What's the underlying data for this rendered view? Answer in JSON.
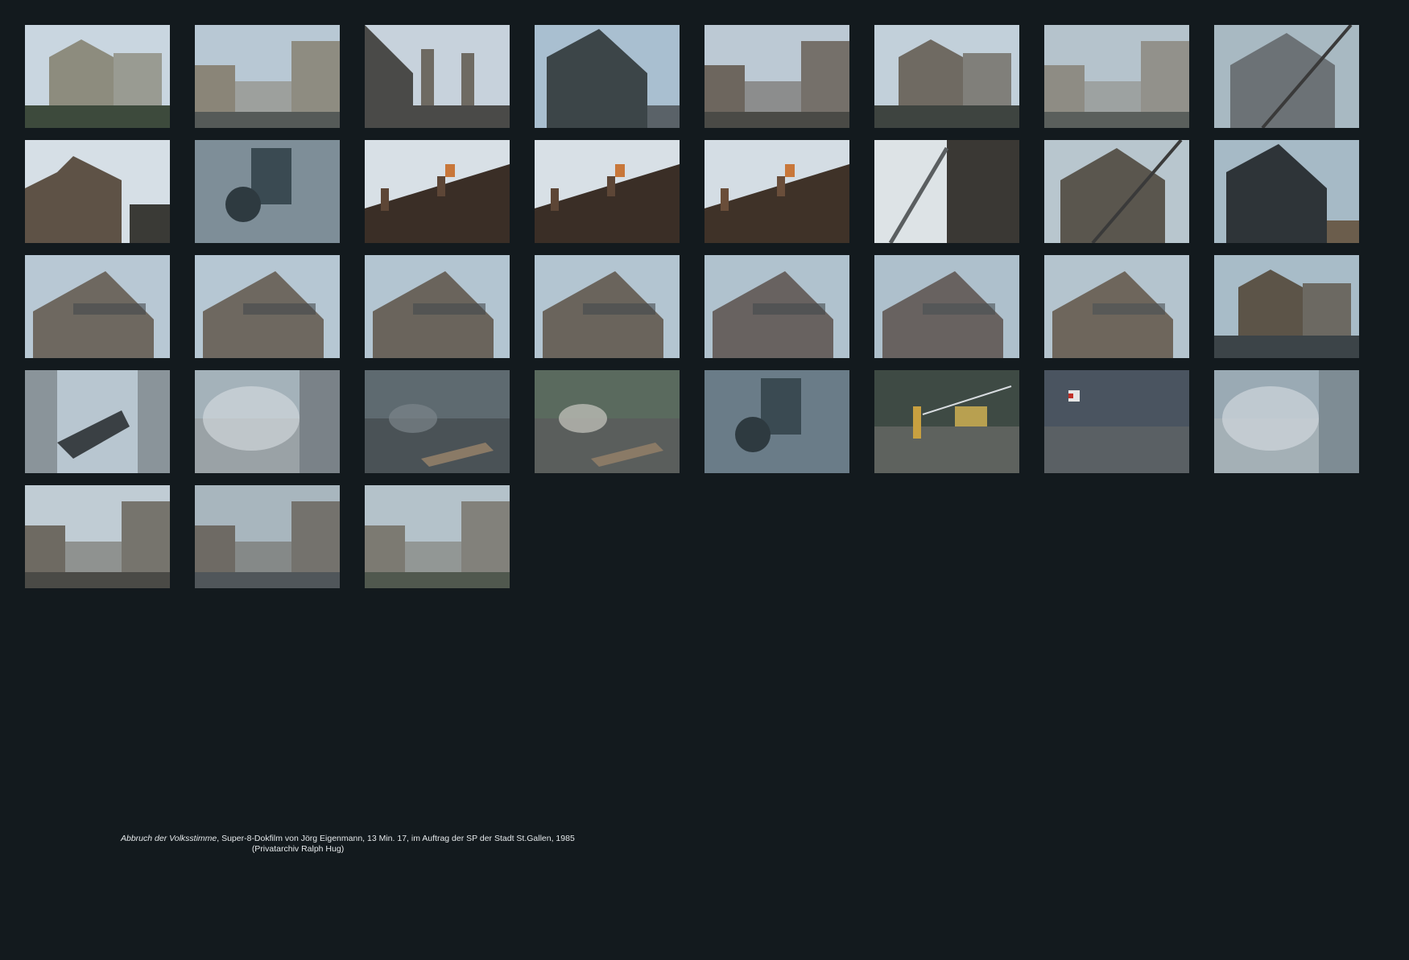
{
  "caption": {
    "title": "Abbruch der Volksstimme",
    "details": ", Super-8-Dokfilm von Jörg Eigenmann, 13 Min. 17, im Auftrag der SP der Stadt St.Gallen, 1985",
    "credit": "(Privatarchiv Ralph Hug)"
  },
  "frames": [
    {
      "name": "film-still-01",
      "scene": "house",
      "sky": "#c9d6e0",
      "ground": "#3d4a3c",
      "tone": "#8d8c7e"
    },
    {
      "name": "film-still-02",
      "scene": "street",
      "sky": "#b8c8d4",
      "ground": "#555a58",
      "tone": "#8a8578"
    },
    {
      "name": "film-still-03",
      "scene": "towers",
      "sky": "#c7d2dc",
      "ground": "#4a4a48",
      "tone": "#6e6a62"
    },
    {
      "name": "film-still-04",
      "scene": "gable",
      "sky": "#a9bfd0",
      "ground": "#3c4548",
      "tone": "#5a6268"
    },
    {
      "name": "film-still-05",
      "scene": "street",
      "sky": "#bcc9d4",
      "ground": "#4a4a46",
      "tone": "#6d665e"
    },
    {
      "name": "film-still-06",
      "scene": "house",
      "sky": "#c2d0da",
      "ground": "#3e4440",
      "tone": "#6f6a62"
    },
    {
      "name": "film-still-07",
      "scene": "street",
      "sky": "#b5c3cc",
      "ground": "#5a5f5c",
      "tone": "#8e8c84"
    },
    {
      "name": "film-still-08",
      "scene": "crane",
      "sky": "#a8b9c2",
      "ground": "#4a5256",
      "tone": "#6c7276"
    },
    {
      "name": "film-still-09",
      "scene": "ruin",
      "sky": "#d6dfe6",
      "ground": "#3a3a36",
      "tone": "#5e5246"
    },
    {
      "name": "film-still-10",
      "scene": "wall",
      "sky": "#9eb2be",
      "ground": "#7e8e98",
      "tone": "#8ea0ac"
    },
    {
      "name": "film-still-11",
      "scene": "roof",
      "sky": "#d8e0e6",
      "ground": "#3a2e26",
      "tone": "#5d4636"
    },
    {
      "name": "film-still-12",
      "scene": "roof",
      "sky": "#d8e0e6",
      "ground": "#3a2e26",
      "tone": "#5d4636"
    },
    {
      "name": "film-still-13",
      "scene": "roof",
      "sky": "#d4dde4",
      "ground": "#3f3228",
      "tone": "#6a4e3a"
    },
    {
      "name": "film-still-14",
      "scene": "ladder",
      "sky": "#cfd8de",
      "ground": "#3a3834",
      "tone": "#7c6a58"
    },
    {
      "name": "film-still-15",
      "scene": "crane",
      "sky": "#b8c6ce",
      "ground": "#3c3e3c",
      "tone": "#5a564e"
    },
    {
      "name": "film-still-16",
      "scene": "gable",
      "sky": "#a6bac6",
      "ground": "#2e3438",
      "tone": "#6b5d4c"
    },
    {
      "name": "film-still-17",
      "scene": "sign",
      "sky": "#b8c8d4",
      "ground": "#454a4c",
      "tone": "#6e6860"
    },
    {
      "name": "film-still-18",
      "scene": "sign",
      "sky": "#b6c7d3",
      "ground": "#454a4c",
      "tone": "#6e6860"
    },
    {
      "name": "film-still-19",
      "scene": "sign",
      "sky": "#b3c5d1",
      "ground": "#454a4c",
      "tone": "#6a645c"
    },
    {
      "name": "film-still-20",
      "scene": "sign",
      "sky": "#b3c5d1",
      "ground": "#454a4c",
      "tone": "#6a645c"
    },
    {
      "name": "film-still-21",
      "scene": "sign",
      "sky": "#b0c2ce",
      "ground": "#454a4c",
      "tone": "#686260"
    },
    {
      "name": "film-still-22",
      "scene": "sign",
      "sky": "#aec0cc",
      "ground": "#4a5054",
      "tone": "#686260"
    },
    {
      "name": "film-still-23",
      "scene": "sign",
      "sky": "#b4c4ce",
      "ground": "#4a5054",
      "tone": "#6e665c"
    },
    {
      "name": "film-still-24",
      "scene": "house",
      "sky": "#a8bcc8",
      "ground": "#3c4448",
      "tone": "#5c5448"
    },
    {
      "name": "film-still-25",
      "scene": "wreck",
      "sky": "#b8c6d0",
      "ground": "#6e7a82",
      "tone": "#8a949a"
    },
    {
      "name": "film-still-26",
      "scene": "dust",
      "sky": "#a4b2ba",
      "ground": "#7a8288",
      "tone": "#9aa2a6"
    },
    {
      "name": "film-still-27",
      "scene": "rubble",
      "sky": "#5e6a70",
      "ground": "#4a5256",
      "tone": "#7a848a"
    },
    {
      "name": "film-still-28",
      "scene": "rubble",
      "sky": "#5a6a5e",
      "ground": "#5a5e5c",
      "tone": "#c8c8c0"
    },
    {
      "name": "film-still-29",
      "scene": "wall",
      "sky": "#8a9ca8",
      "ground": "#6a7c88",
      "tone": "#9aa8b2"
    },
    {
      "name": "film-still-30",
      "scene": "hose",
      "sky": "#3e4a44",
      "ground": "#5e625e",
      "tone": "#c8a040"
    },
    {
      "name": "film-still-31",
      "scene": "storefront",
      "sky": "#6a7278",
      "ground": "#5a6064",
      "tone": "#4a5460"
    },
    {
      "name": "film-still-32",
      "scene": "dust",
      "sky": "#9aaab4",
      "ground": "#7e8c94",
      "tone": "#a4b0b6"
    },
    {
      "name": "film-still-33",
      "scene": "street",
      "sky": "#c0ccd4",
      "ground": "#4a4a46",
      "tone": "#6e6a62"
    },
    {
      "name": "film-still-34",
      "scene": "street",
      "sky": "#a8b6be",
      "ground": "#50565a",
      "tone": "#6e6a64"
    },
    {
      "name": "film-still-35",
      "scene": "street",
      "sky": "#b4c2ca",
      "ground": "#50584e",
      "tone": "#7c7a72"
    }
  ]
}
